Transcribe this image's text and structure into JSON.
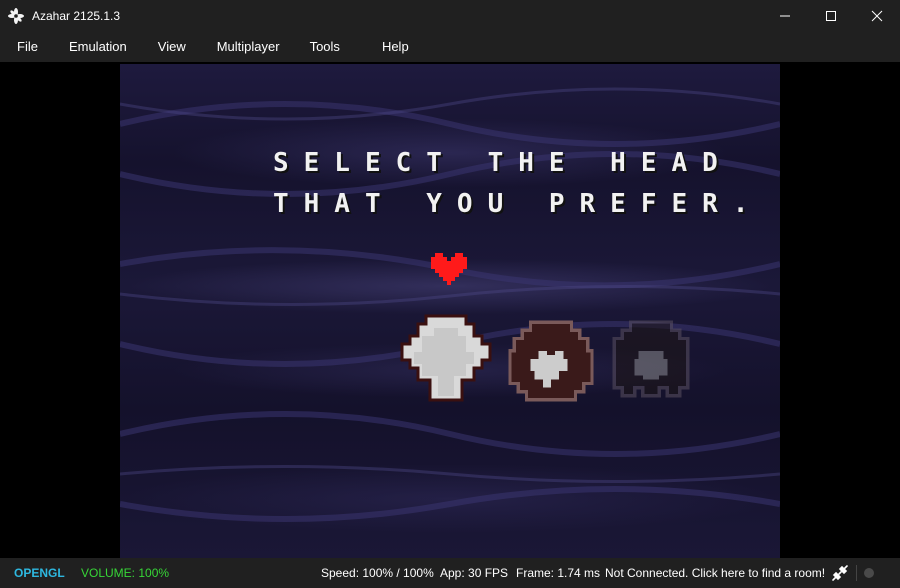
{
  "window": {
    "title": "Azahar 2125.1.3",
    "app_icon": "azahar-flower-icon",
    "controls": [
      "minimize-icon",
      "maximize-icon",
      "close-icon"
    ]
  },
  "menu": {
    "items": [
      {
        "label": "File"
      },
      {
        "label": "Emulation"
      },
      {
        "label": "View"
      },
      {
        "label": "Multiplayer"
      },
      {
        "label": "Tools"
      },
      {
        "label": "Help"
      }
    ]
  },
  "game": {
    "prompt_line1": "SELECT THE HEAD",
    "prompt_line2": "THAT YOU PREFER.",
    "cursor_icon": "red-heart-soul-icon",
    "options": [
      {
        "name": "head-option-1",
        "state": "selected"
      },
      {
        "name": "head-option-2",
        "state": "normal"
      },
      {
        "name": "head-option-3",
        "state": "dimmed"
      }
    ]
  },
  "status": {
    "renderer": "OPENGL",
    "volume": "VOLUME: 100%",
    "speed": "Speed: 100% / 100%",
    "app_fps": "App: 30 FPS",
    "frame": "Frame: 1.74 ms",
    "network": "Not Connected. Click here to find a room!",
    "network_icon": "network-disconnected-icon",
    "colors": {
      "renderer": "#2eb8e0",
      "volume": "#37d637"
    }
  }
}
